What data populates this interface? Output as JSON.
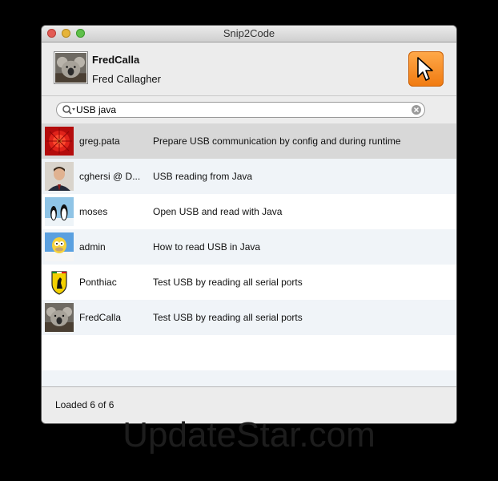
{
  "window": {
    "title": "Snip2Code"
  },
  "user": {
    "handle": "FredCalla",
    "full_name": "Fred Callagher",
    "avatar": "koala-photo"
  },
  "toolbar": {
    "pointer_button_icon": "cursor-pointer-icon",
    "accent_color": "#f58a1f"
  },
  "search": {
    "value": "USB java",
    "icon": "search-icon",
    "clear_icon": "clear-icon"
  },
  "snippets": [
    {
      "user": "greg.pata",
      "title": "Prepare USB communication by config and during runtime",
      "avatar": "red-flower-photo"
    },
    {
      "user": "cghersi @ D...",
      "title": "USB reading from Java",
      "avatar": "man-portrait-photo"
    },
    {
      "user": "moses",
      "title": "Open USB and read with Java",
      "avatar": "penguins-photo"
    },
    {
      "user": "admin",
      "title": "How to read USB in Java",
      "avatar": "cartoon-character"
    },
    {
      "user": "Ponthiac",
      "title": "Test USB by reading all serial ports",
      "avatar": "ferrari-logo"
    },
    {
      "user": "FredCalla",
      "title": "Test USB by reading all serial ports",
      "avatar": "koala-photo"
    }
  ],
  "status": {
    "text": "Loaded 6 of 6"
  },
  "watermark": {
    "text": "UpdateStar.com"
  }
}
